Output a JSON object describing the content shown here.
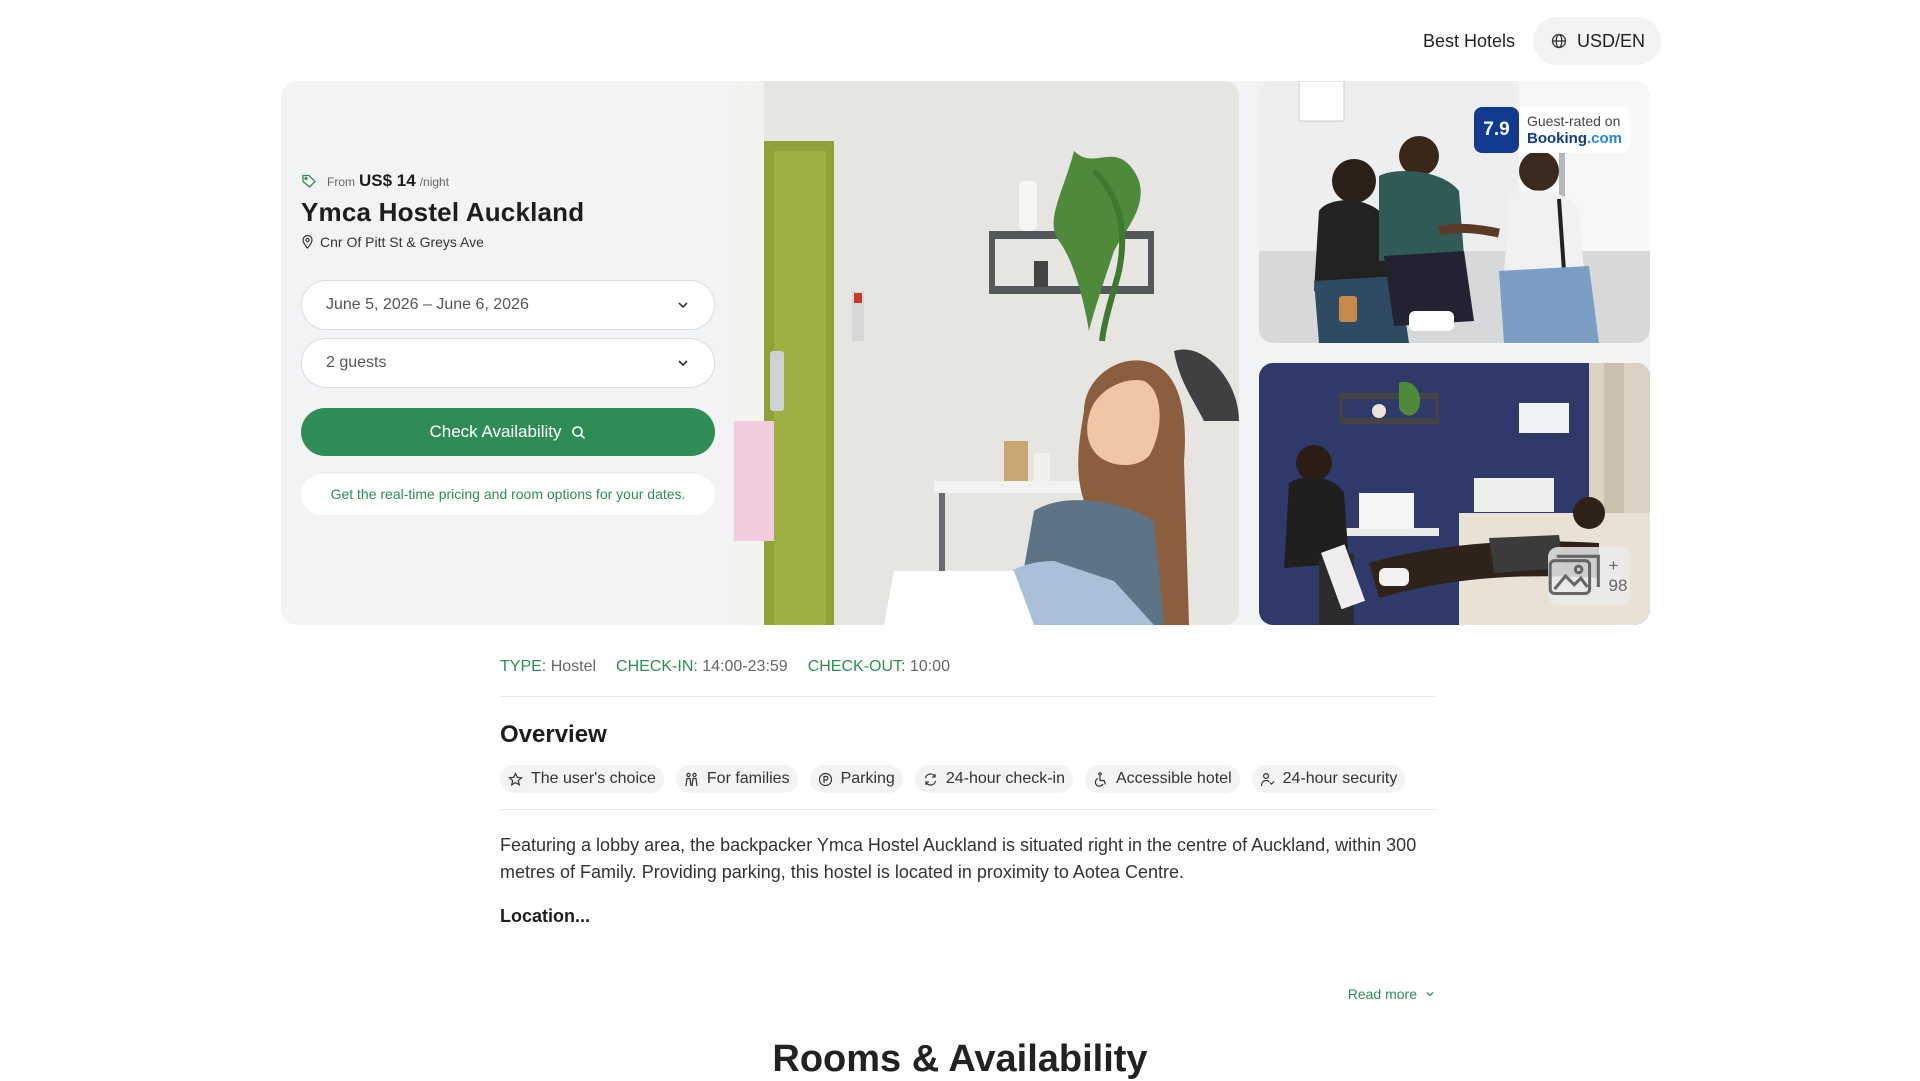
{
  "header": {
    "brand_link": "Best Hotels",
    "locale": "USD/EN"
  },
  "hotel": {
    "price_prefix": "From",
    "price": "US$ 14",
    "price_suffix": "/night",
    "name": "Ymca Hostel Auckland",
    "address": "Cnr Of Pitt St & Greys Ave",
    "dates": "June 5, 2026 – June 6, 2026",
    "guests": "2 guests",
    "check_button": "Check Availability",
    "note": "Get the real-time pricing and room options for your dates."
  },
  "rating": {
    "score": "7.9",
    "label": "Guest-rated on",
    "brand_main": "Booking",
    "brand_suffix": ".com"
  },
  "gallery": {
    "more_count": "+ 98"
  },
  "meta": {
    "type_label": "TYPE:",
    "type_value": "Hostel",
    "checkin_label": "CHECK-IN:",
    "checkin_value": "14:00-23:59",
    "checkout_label": "CHECK-OUT:",
    "checkout_value": "10:00"
  },
  "overview": {
    "title": "Overview",
    "chips": [
      {
        "label": "The user's choice",
        "icon": "star-icon"
      },
      {
        "label": "For families",
        "icon": "family-icon"
      },
      {
        "label": "Parking",
        "icon": "parking-icon"
      },
      {
        "label": "24-hour check-in",
        "icon": "refresh-icon"
      },
      {
        "label": "Accessible hotel",
        "icon": "wheelchair-icon"
      },
      {
        "label": "24-hour security",
        "icon": "security-icon"
      }
    ],
    "description": "Featuring a lobby area, the backpacker Ymca Hostel Auckland is situated right in the centre of Auckland, within 300 metres of Family. Providing parking, this hostel is located in proximity to Aotea Centre.",
    "location_heading": "Location...",
    "read_more": "Read more"
  },
  "rooms": {
    "title": "Rooms & Availability"
  },
  "colors": {
    "accent_green": "#2f8c57",
    "booking_blue": "#123a8f",
    "panel_bg": "#f1f3f5"
  }
}
